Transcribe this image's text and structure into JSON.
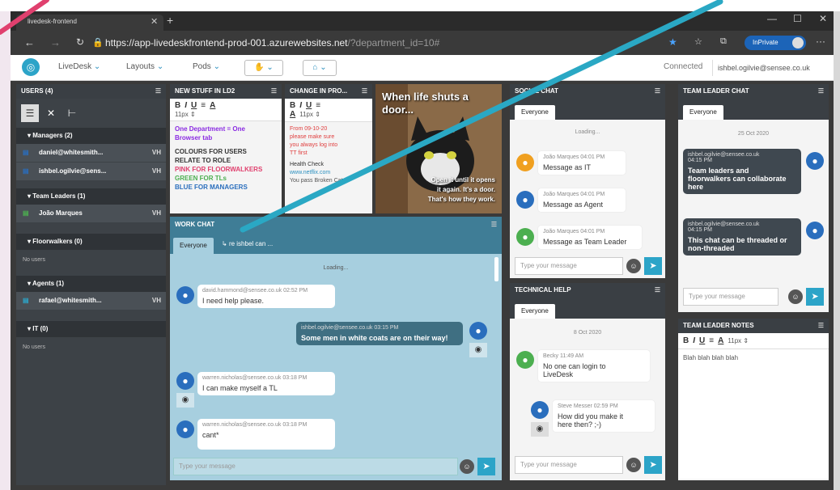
{
  "browser": {
    "tab_title": "livedesk-frontend",
    "url_main": "https://app-livedeskfrontend-prod-001.azurewebsites.net",
    "url_tail": "/?department_id=10#",
    "inprivate": "InPrivate"
  },
  "nav": {
    "items": [
      "LiveDesk",
      "Layouts",
      "Pods"
    ],
    "status": "Connected",
    "user": "ishbel.ogilvie@sensee.co.uk"
  },
  "users_panel": {
    "title": "USERS (4)",
    "groups": [
      {
        "label": "Managers (2)",
        "users": [
          {
            "name": "daniel@whitesmith...",
            "tag": "VH"
          },
          {
            "name": "ishbel.ogilvie@sens...",
            "tag": "VH"
          }
        ]
      },
      {
        "label": "Team Leaders (1)",
        "users": [
          {
            "name": "João Marques",
            "tag": "VH"
          }
        ]
      },
      {
        "label": "Floorwalkers (0)",
        "users": [],
        "empty": "No users"
      },
      {
        "label": "Agents (1)",
        "users": [
          {
            "name": "rafael@whitesmith...",
            "tag": "VH"
          }
        ]
      },
      {
        "label": "IT (0)",
        "users": [],
        "empty": "No users"
      }
    ]
  },
  "new_stuff": {
    "title": "NEW STUFF IN LD2",
    "size": "11px",
    "l1": "One Department = One",
    "l2": "Browser tab",
    "l3": "COLOURS FOR USERS",
    "l4": "RELATE TO ROLE",
    "l5": "PINK FOR FLOORWALKERS",
    "l6": "GREEN FOR TLs",
    "l7": "BLUE FOR MANAGERS"
  },
  "change_in": {
    "title": "CHANGE IN PRO...",
    "size": "11px",
    "l1": "From 09-10-20",
    "l2": "please make sure",
    "l3": "you always log into",
    "l4": "TT first",
    "l5": "Health Check",
    "l6": "www.netflix.com",
    "l7": "You pass Broken Cat"
  },
  "meme": {
    "top": "When life shuts a",
    "top2": "door...",
    "b1": "Open it until it opens",
    "b2": "it again. It's a door.",
    "b3": "That's how they work."
  },
  "work_chat": {
    "title": "WORK CHAT",
    "tab_everyone": "Everyone",
    "tab_thread": "re ishbel can ...",
    "loading": "Loading...",
    "m1_meta": "david.hammond@sensee.co.uk  02:52 PM",
    "m1_text": "I need help please.",
    "m2_meta": "ishbel.ogilvie@sensee.co.uk  03:15 PM",
    "m2_text": "Some men in white coats are on their way!",
    "m3_meta": "warren.nicholas@sensee.co.uk  03:18 PM",
    "m3_text": "I can make myself a TL",
    "m4_meta": "warren.nicholas@sensee.co.uk  03:18 PM",
    "m4_text": "cant*",
    "placeholder": "Type your message"
  },
  "social_chat": {
    "title": "SOCIAL CHAT",
    "tab": "Everyone",
    "loading": "Loading...",
    "m1_meta": "João Marques  04:01 PM",
    "m1_text": "Message as IT",
    "m2_meta": "João Marques  04:01 PM",
    "m2_text": "Message as Agent",
    "m3_meta": "João Marques  04:01 PM",
    "m3_text": "Message as Team Leader",
    "placeholder": "Type your message"
  },
  "tech_help": {
    "title": "TECHNICAL HELP",
    "tab": "Everyone",
    "date": "8 Oct 2020",
    "m1_meta": "Becky  11:49 AM",
    "m1_l1": "No one can login to",
    "m1_l2": "LiveDesk",
    "m2_meta": "Steve Messer  02:59 PM",
    "m2_l1": "How did you make it",
    "m2_l2": "here then? ;-)",
    "placeholder": "Type your message"
  },
  "tl_chat": {
    "title": "TEAM LEADER CHAT",
    "tab": "Everyone",
    "date": "25 Oct 2020",
    "m1_meta": "ishbel.ogilvie@sensee.co.uk",
    "m1_time": "04:15 PM",
    "m1_l1": "Team leaders and",
    "m1_l2": "floorwalkers can collaborate",
    "m1_l3": "here",
    "m2_meta": "ishbel.ogilvie@sensee.co.uk",
    "m2_time": "04:15 PM",
    "m2_l1": "This chat can be threaded or",
    "m2_l2": "non-threaded",
    "placeholder": "Type your message"
  },
  "tl_notes": {
    "title": "TEAM LEADER NOTES",
    "size": "11px",
    "text": "Blah blah blah blah"
  },
  "colors": {
    "accent": "#2ca4c8",
    "manager": "#2a6ebd",
    "teamleader": "#4caf50",
    "floorwalker": "#e0406e",
    "it": "#f0a020"
  }
}
